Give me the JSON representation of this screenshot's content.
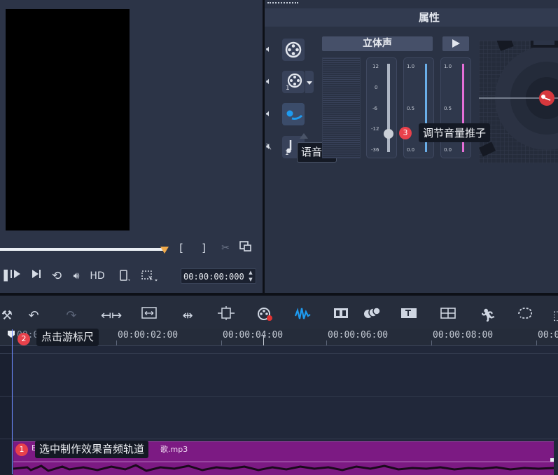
{
  "preview": {
    "bracket_in": "[",
    "bracket_out": "]",
    "quality_label": "HD",
    "timecode": "00:00:00:000"
  },
  "properties": {
    "title": "属性",
    "stereo_label": "立体声",
    "track_tooltip": "语音轨",
    "track_badge_1": "1",
    "track_badge_2": "1",
    "fader_db_scale": [
      "12",
      "0",
      "-6",
      "-12",
      "-36"
    ],
    "fader_scale": [
      "1.0",
      "0.5",
      "0.0"
    ],
    "fader_level_db": -12
  },
  "annotations": {
    "step1_num": "1",
    "step1_text": "选中制作效果音频轨道",
    "step2_num": "2",
    "step2_text": "点击游标尺",
    "step3_num": "3",
    "step3_text": "调节音量推子"
  },
  "ruler": {
    "ticks": [
      "00:00:00:00",
      "00:00:02:00",
      "00:00:04:00",
      "00:00:06:00",
      "00:00:08:00",
      "00:00:"
    ]
  },
  "clip": {
    "name_prefix": "E",
    "name_suffix": "歌.mp3",
    "color": "#7c1a83"
  },
  "colors": {
    "accent_red": "#e8414b",
    "fader_blue": "#6aaee8",
    "fader_pink": "#e46fd7",
    "scrub_handle": "#f0a94a"
  }
}
